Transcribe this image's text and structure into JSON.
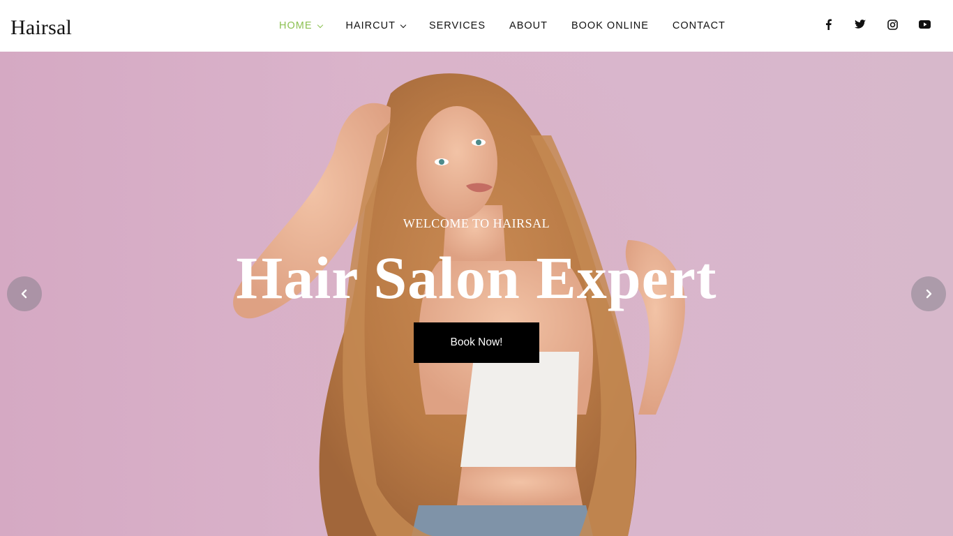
{
  "brand": {
    "name": "Hairsal"
  },
  "nav": {
    "items": [
      {
        "label": "HOME",
        "has_dropdown": true,
        "active": true
      },
      {
        "label": "HAIRCUT",
        "has_dropdown": true,
        "active": false
      },
      {
        "label": "SERVICES",
        "has_dropdown": false,
        "active": false
      },
      {
        "label": "ABOUT",
        "has_dropdown": false,
        "active": false
      },
      {
        "label": "BOOK ONLINE",
        "has_dropdown": false,
        "active": false
      },
      {
        "label": "CONTACT",
        "has_dropdown": false,
        "active": false
      }
    ]
  },
  "social": {
    "icons": [
      "facebook-icon",
      "twitter-icon",
      "instagram-icon",
      "youtube-icon"
    ]
  },
  "hero": {
    "eyebrow": "WELCOME TO HAIRSAL",
    "title": "Hair Salon Expert",
    "cta_label": "Book Now!",
    "prev_icon": "chevron-left-icon",
    "next_icon": "chevron-right-icon"
  },
  "colors": {
    "accent": "#8cc152",
    "header_background": "#ffffff",
    "nav_text": "#111111",
    "hero_background": "#d9b4c9",
    "cta_background": "#000000",
    "cta_text": "#ffffff",
    "hero_text": "#ffffff"
  }
}
